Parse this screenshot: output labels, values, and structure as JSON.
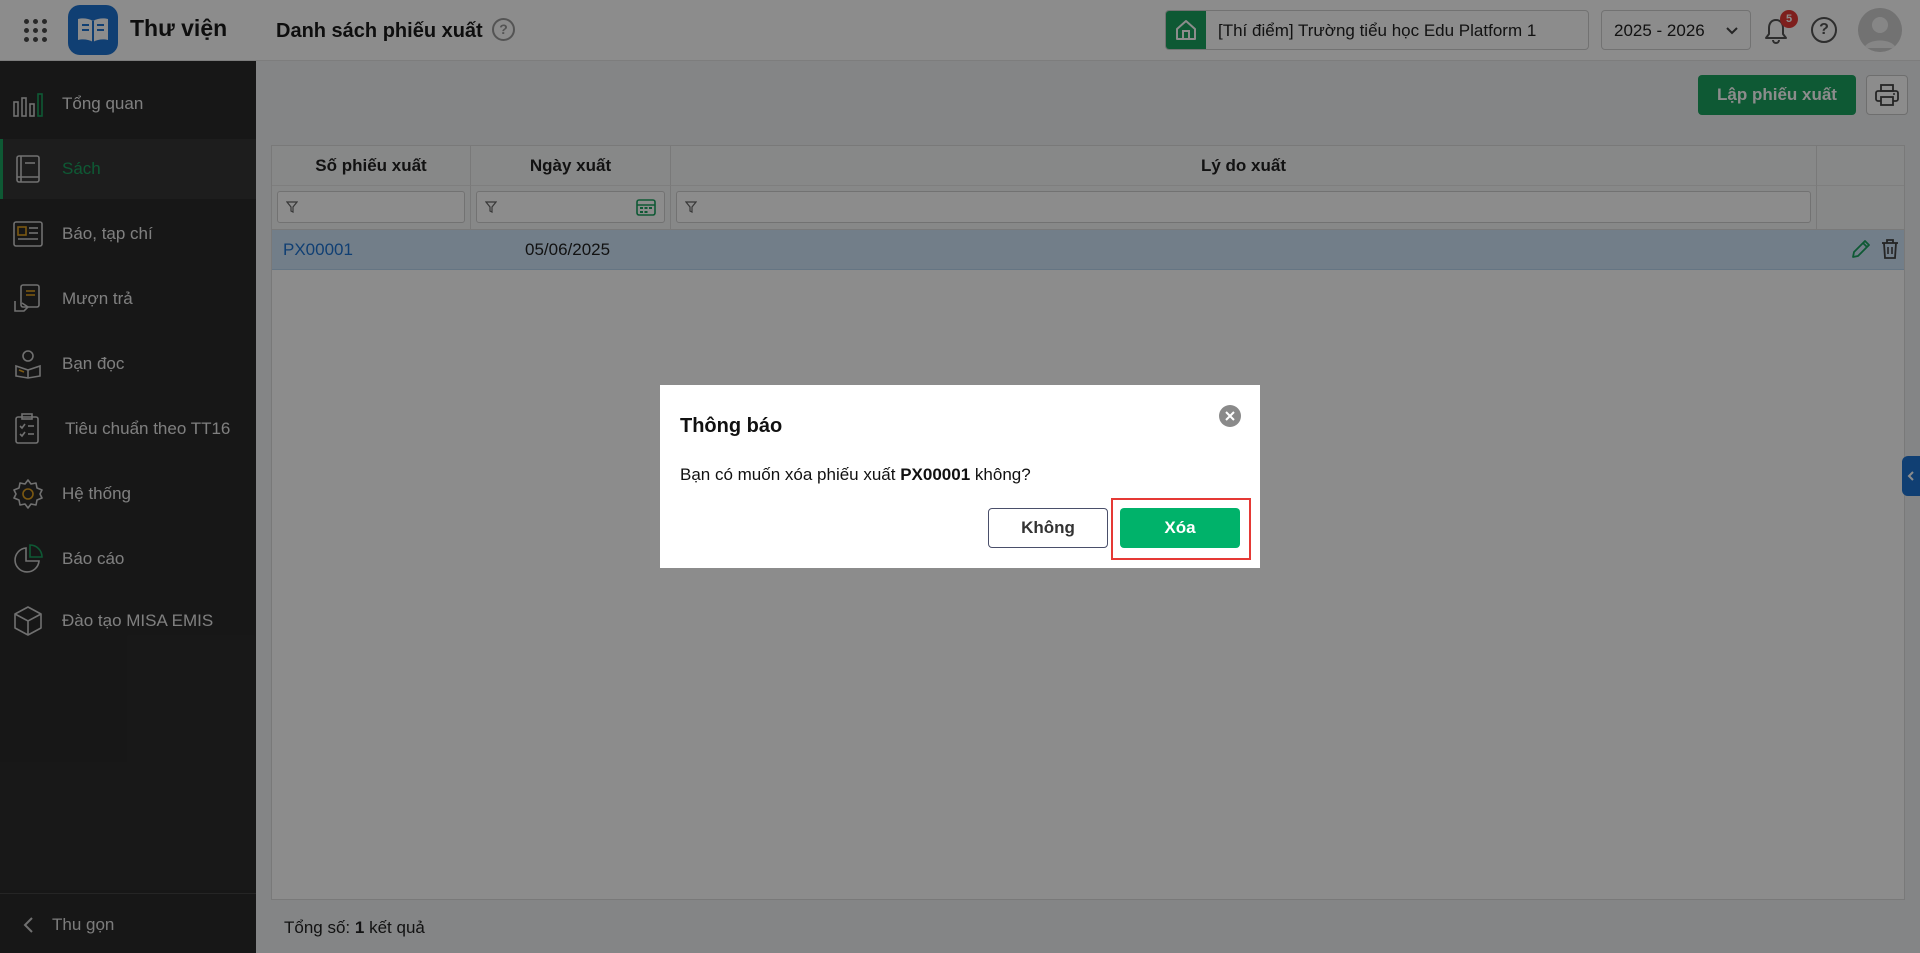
{
  "header": {
    "app_name": "Thư viện",
    "page_title": "Danh sách phiếu xuất",
    "help_title_glyph": "?",
    "school": "[Thí điểm] Trường tiểu học Edu Platform 1",
    "school_year": "2025 - 2026",
    "notification_count": "5",
    "help_glyph": "?"
  },
  "sidebar": {
    "items": [
      {
        "label": "Tổng quan",
        "icon": "chart-bars-icon"
      },
      {
        "label": "Sách",
        "icon": "book-icon"
      },
      {
        "label": "Báo, tạp chí",
        "icon": "newspaper-icon"
      },
      {
        "label": "Mượn trả",
        "icon": "borrow-icon"
      },
      {
        "label": "Bạn đọc",
        "icon": "reader-icon"
      },
      {
        "label": "Tiêu chuẩn theo TT16",
        "icon": "checklist-icon"
      },
      {
        "label": "Hệ thống",
        "icon": "gear-icon"
      },
      {
        "label": "Báo cáo",
        "icon": "pie-chart-icon"
      },
      {
        "label": "Đào tạo MISA EMIS",
        "icon": "cube-icon"
      }
    ],
    "active_index": 1,
    "collapse_label": "Thu gọn"
  },
  "toolbar": {
    "create_label": "Lập phiếu xuất"
  },
  "grid": {
    "columns": [
      "Số phiếu xuất",
      "Ngày xuất",
      "Lý do xuất"
    ],
    "rows": [
      {
        "number": "PX00001",
        "date": "05/06/2025",
        "reason": ""
      }
    ]
  },
  "footer": {
    "total_label": "Tổng số:",
    "total_count": "1",
    "total_suffix": "kết quả"
  },
  "dialog": {
    "title": "Thông báo",
    "message_prefix": "Bạn có muốn xóa phiếu xuất",
    "message_code": "PX00001",
    "message_suffix": "không?",
    "no_label": "Không",
    "delete_label": "Xóa"
  },
  "colors": {
    "accent_green": "#1aa260",
    "delete_green": "#00b26a",
    "link_blue": "#1e73d2",
    "selected_row": "#cfe6fa",
    "sidebar_bg": "#2b2b2b",
    "highlight_red": "#e53935"
  }
}
